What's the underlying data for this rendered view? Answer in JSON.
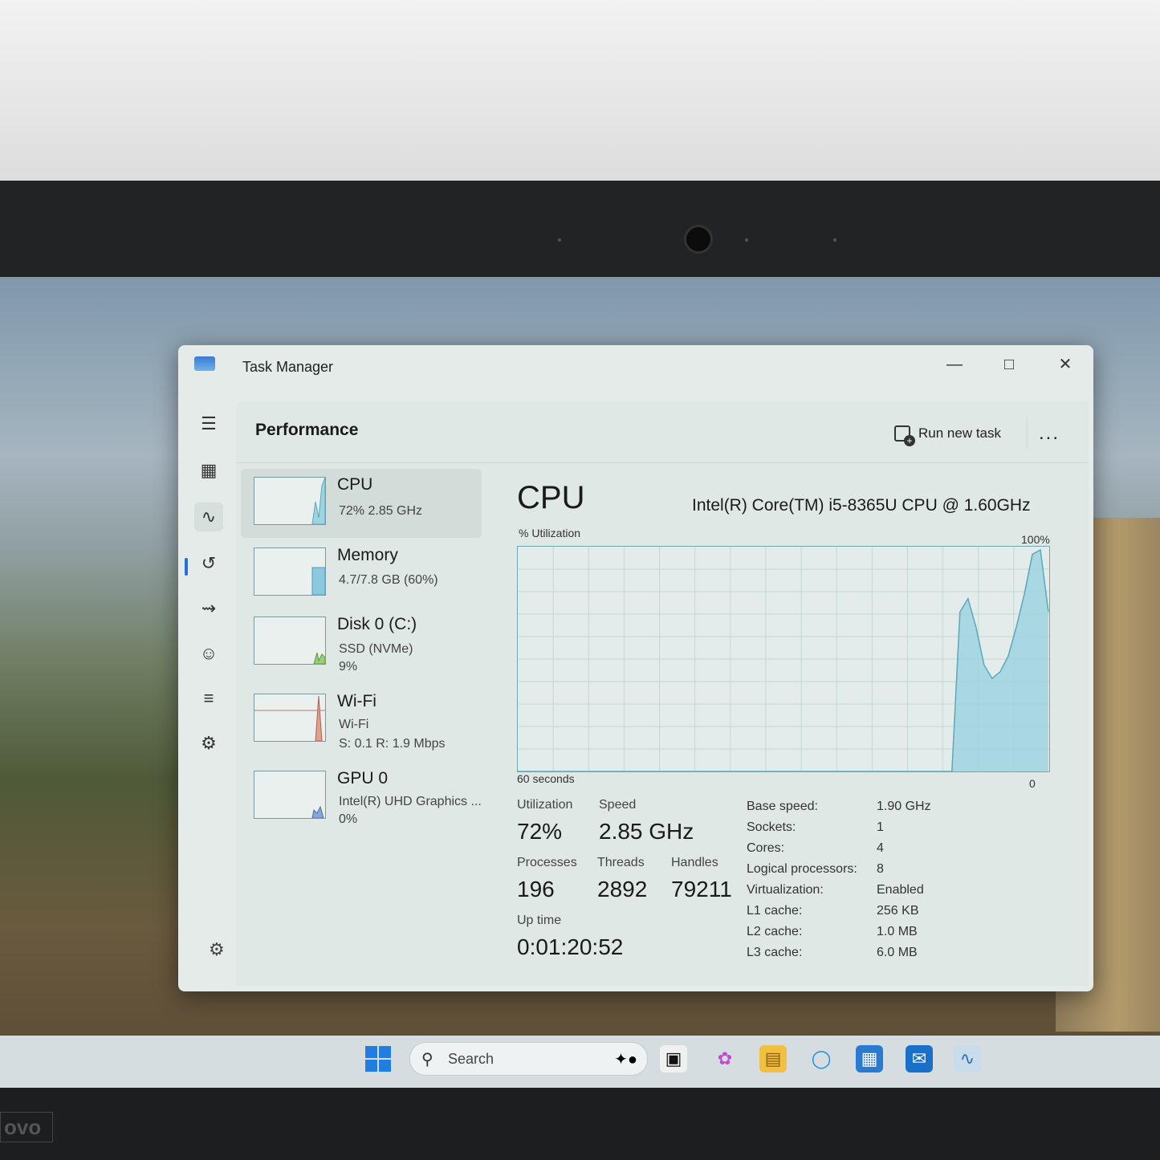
{
  "window": {
    "title": "Task Manager"
  },
  "header": {
    "page_title": "Performance",
    "run_task_label": "Run new task",
    "more_label": "..."
  },
  "titlebar": {
    "minimize": "—",
    "maximize": "□",
    "close": "✕"
  },
  "resources": [
    {
      "name": "CPU",
      "sub1": "72%  2.85 GHz",
      "sub2": "",
      "selected": true,
      "color": "#9fd3e0"
    },
    {
      "name": "Memory",
      "sub1": "4.7/7.8 GB (60%)",
      "sub2": "",
      "selected": false,
      "color": "#8cc8e0"
    },
    {
      "name": "Disk 0 (C:)",
      "sub1": "SSD (NVMe)",
      "sub2": "9%",
      "selected": false,
      "color": "#9ccc7a"
    },
    {
      "name": "Wi-Fi",
      "sub1": "Wi-Fi",
      "sub2": "S: 0.1  R: 1.9 Mbps",
      "selected": false,
      "color": "#e0a090"
    },
    {
      "name": "GPU 0",
      "sub1": "Intel(R) UHD Graphics ...",
      "sub2": "0%",
      "selected": false,
      "color": "#8aa6d8"
    }
  ],
  "cpu": {
    "title": "CPU",
    "model": "Intel(R) Core(TM) i5-8365U CPU @ 1.60GHz",
    "utilization_label": "% Utilization",
    "max_label": "100%",
    "time_label": "60 seconds",
    "zero_label": "0",
    "history_percent": [
      0,
      0,
      0,
      0,
      0,
      0,
      0,
      0,
      0,
      0,
      0,
      0,
      0,
      0,
      0,
      0,
      0,
      0,
      0,
      0,
      0,
      0,
      0,
      0,
      0,
      0,
      0,
      0,
      0,
      0,
      0,
      0,
      0,
      0,
      0,
      0,
      0,
      0,
      0,
      0,
      0,
      0,
      0,
      0,
      0,
      0,
      0,
      0,
      0,
      0,
      0,
      0,
      0,
      0,
      0,
      72,
      78,
      65,
      48,
      42,
      45,
      52,
      65,
      80,
      98,
      100,
      72
    ],
    "stats": {
      "utilization": {
        "label": "Utilization",
        "value": "72%"
      },
      "speed": {
        "label": "Speed",
        "value": "2.85 GHz"
      },
      "processes": {
        "label": "Processes",
        "value": "196"
      },
      "threads": {
        "label": "Threads",
        "value": "2892"
      },
      "handles": {
        "label": "Handles",
        "value": "79211"
      },
      "uptime": {
        "label": "Up time",
        "value": "0:01:20:52"
      }
    },
    "specs": [
      {
        "label": "Base speed:",
        "value": "1.90 GHz"
      },
      {
        "label": "Sockets:",
        "value": "1"
      },
      {
        "label": "Cores:",
        "value": "4"
      },
      {
        "label": "Logical processors:",
        "value": "8"
      },
      {
        "label": "Virtualization:",
        "value": "Enabled"
      },
      {
        "label": "L1 cache:",
        "value": "256 KB"
      },
      {
        "label": "L2 cache:",
        "value": "1.0 MB"
      },
      {
        "label": "L3 cache:",
        "value": "6.0 MB"
      }
    ]
  },
  "nav_icons": [
    "hamburger-icon",
    "processes-icon",
    "performance-icon",
    "app-history-icon",
    "startup-apps-icon",
    "users-icon",
    "details-icon",
    "services-icon"
  ],
  "taskbar": {
    "search_label": "Search"
  },
  "colors": {
    "graph_fill": "#9fd3e0",
    "graph_line": "#5aa8bb",
    "grid": "#c3d8d6",
    "accent": "#2b6fd6"
  }
}
